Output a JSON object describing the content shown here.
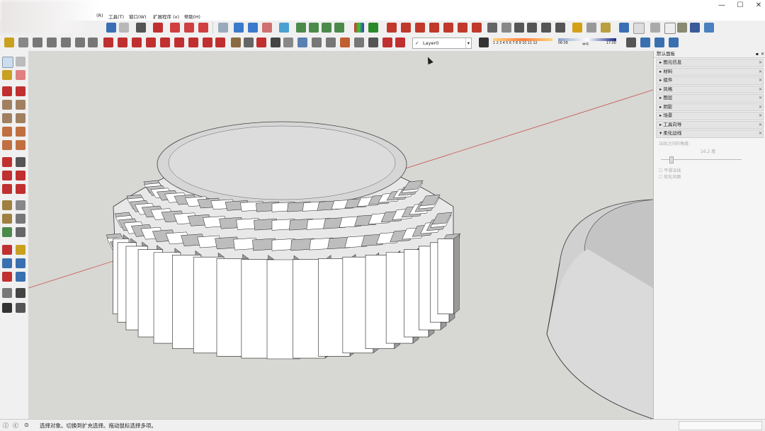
{
  "menu": {
    "items": [
      "(R)",
      "工具(T)",
      "窗口(W)",
      "扩展程序 (x)",
      "帮助(H)"
    ]
  },
  "window_controls": {
    "minimize": "—",
    "maximize": "☐",
    "close": "✕"
  },
  "layer": {
    "name": "Layer0"
  },
  "shadow_bar": {
    "months": "1 2 3 4 5 6 7 8 9 10 11 12",
    "time_start": "06:58",
    "time_mid": "中午",
    "time_end": "17:00"
  },
  "panel": {
    "title": "默认面板",
    "trays": [
      "图元信息",
      "材料",
      "组件",
      "风格",
      "图层",
      "阴影",
      "场景",
      "工具向导",
      "柔化边线"
    ],
    "softening": {
      "angle_label": "法线之间的角度:",
      "angle_value": "16.2",
      "angle_unit": "度",
      "option_smooth": "平滑法线",
      "option_soften": "软化共面"
    }
  },
  "status": {
    "message": "选择对象。切换到扩充选择。拖动鼠标选择多项。"
  },
  "colors": {
    "viewport_bg": "#d7d7d3",
    "red_axis": "#c85050",
    "model_face": "#ffffff",
    "model_shade": "#9a9a9a"
  }
}
